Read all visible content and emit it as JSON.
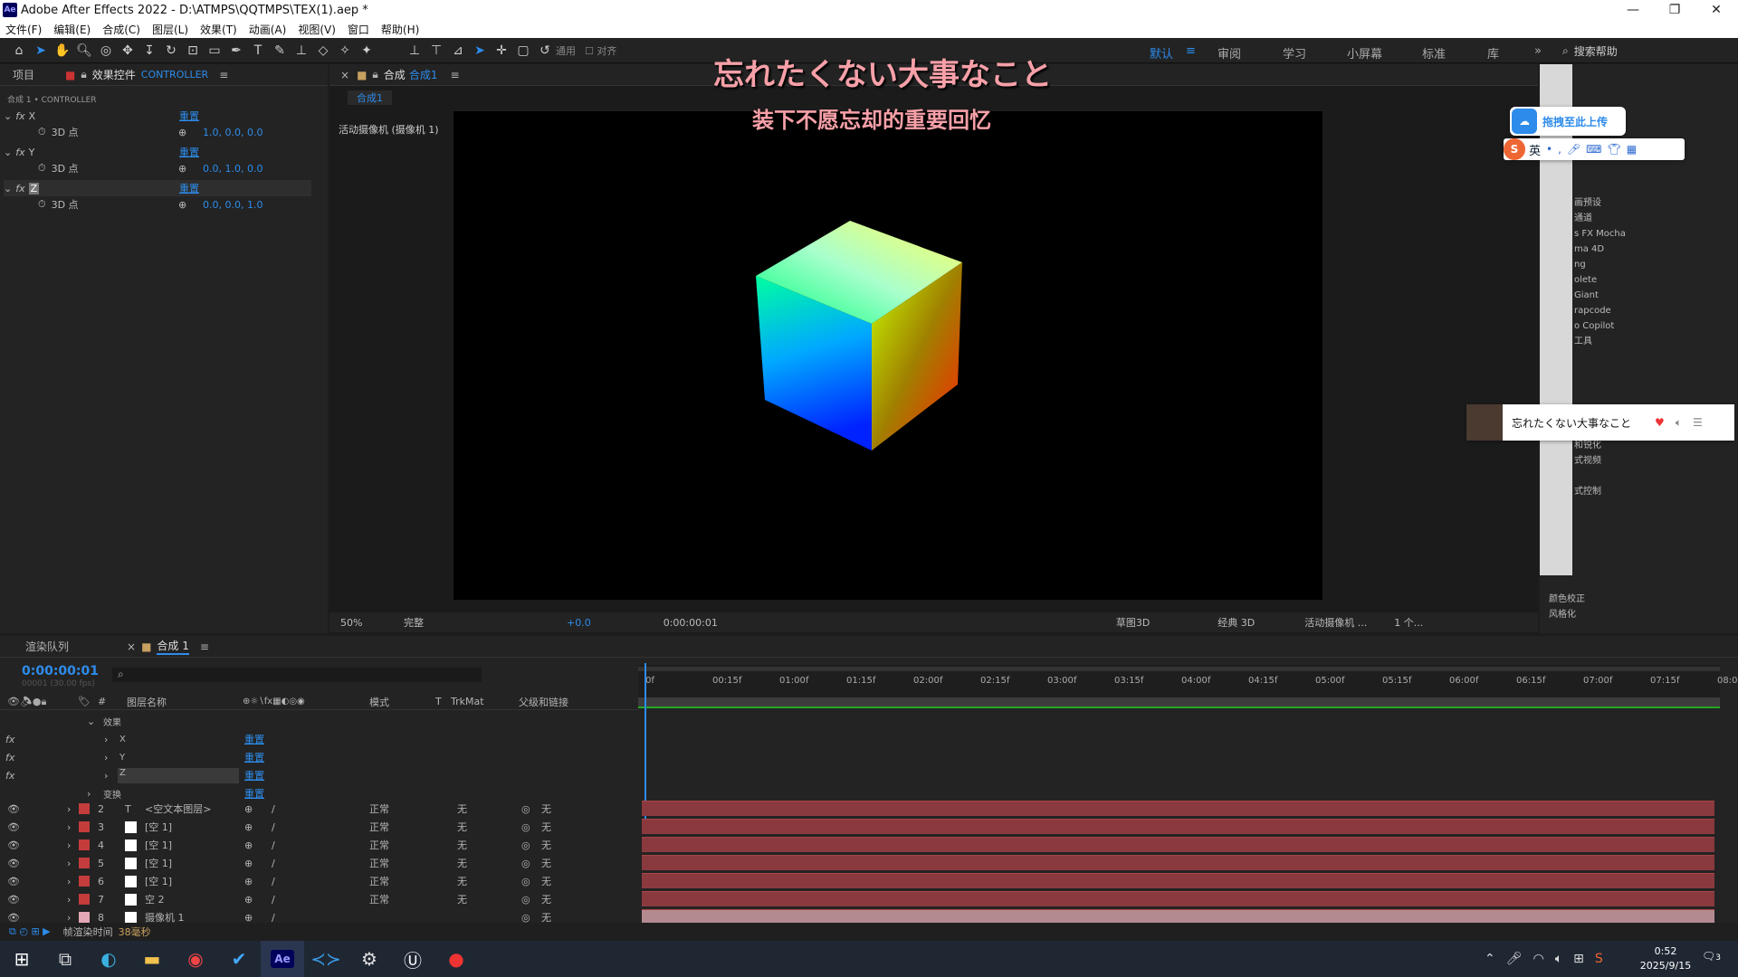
{
  "window": {
    "title": "Adobe After Effects 2022 - D:\\ATMPS\\QQTMPS\\TEX(1).aep *"
  },
  "menu": [
    "文件(F)",
    "编辑(E)",
    "合成(C)",
    "图层(L)",
    "效果(T)",
    "动画(A)",
    "视图(V)",
    "窗口",
    "帮助(H)"
  ],
  "toolbar": {
    "general": "通用",
    "align": "对齐"
  },
  "workspaces": [
    "默认",
    "审阅",
    "学习",
    "小屏幕",
    "标准",
    "库"
  ],
  "search_help": "搜索帮助",
  "overlay": {
    "jp": "忘れたくない大事なこと",
    "cn": "装下不愿忘却的重要回忆"
  },
  "effects_panel": {
    "tab_project": "项目",
    "tab_effects": "效果控件",
    "tab_target": "CONTROLLER",
    "breadcrumb": "合成 1 • CONTROLLER",
    "reset": "重置",
    "point_label": "3D 点",
    "effects": [
      {
        "name": "X",
        "value": "1.0, 0.0, 0.0"
      },
      {
        "name": "Y",
        "value": "0.0, 1.0, 0.0"
      },
      {
        "name": "Z",
        "value": "0.0, 0.0, 1.0"
      }
    ]
  },
  "comp_panel": {
    "tab": "合成",
    "comp_name": "合成1",
    "sub_tab": "合成1",
    "camera_label": "活动摄像机 (摄像机 1)",
    "zoom": "50%",
    "quality": "完整",
    "exposure": "+0.0",
    "timecode": "0:00:00:01",
    "draft3d": "草图3D",
    "renderer": "经典 3D",
    "camera": "活动摄像机 ...",
    "views": "1 个..."
  },
  "baidu_upload": "拖拽至此上传",
  "ime": {
    "lang": "英"
  },
  "music_popup": {
    "title": "忘れたくない大事なこと"
  },
  "right_panel_items": [
    "画预设",
    "通道",
    "s FX Mocha",
    "ma 4D",
    "ng",
    "olete",
    "Giant",
    "rapcode",
    "o Copilot",
    "工具",
    "和锐化",
    "式视频",
    "式控制",
    "颜色校正",
    "风格化"
  ],
  "timeline": {
    "tab_render": "渲染队列",
    "tab_comp": "合成 1",
    "timecode": "0:00:00:01",
    "fps": "00001 (30.00 fps)",
    "col_name": "图层名称",
    "col_mode": "模式",
    "col_t": "T",
    "col_trkmat": "TrkMat",
    "col_parent": "父级和链接",
    "effects_group": "效果",
    "sub_effects": [
      "X",
      "Y",
      "Z"
    ],
    "transform": "变换",
    "reset": "重置",
    "ticks": [
      "0f",
      "00:15f",
      "01:00f",
      "01:15f",
      "02:00f",
      "02:15f",
      "03:00f",
      "03:15f",
      "04:00f",
      "04:15f",
      "05:00f",
      "05:15f",
      "06:00f",
      "06:15f",
      "07:00f",
      "07:15f",
      "08:0"
    ],
    "layers": [
      {
        "num": "2",
        "icon": "T",
        "name": "<空文本图层>",
        "mode": "正常",
        "trk": "无",
        "parent": "无"
      },
      {
        "num": "3",
        "icon": "",
        "name": "[空 1]",
        "mode": "正常",
        "trk": "无",
        "parent": "无"
      },
      {
        "num": "4",
        "icon": "",
        "name": "[空 1]",
        "mode": "正常",
        "trk": "无",
        "parent": "无"
      },
      {
        "num": "5",
        "icon": "",
        "name": "[空 1]",
        "mode": "正常",
        "trk": "无",
        "parent": "无"
      },
      {
        "num": "6",
        "icon": "",
        "name": "[空 1]",
        "mode": "正常",
        "trk": "无",
        "parent": "无"
      },
      {
        "num": "7",
        "icon": "",
        "name": "空 2",
        "mode": "正常",
        "trk": "无",
        "parent": "无"
      },
      {
        "num": "8",
        "icon": "",
        "name": "摄像机 1",
        "mode": "",
        "trk": "",
        "parent": "无"
      }
    ],
    "render_time_label": "帧渲染时间",
    "render_time": "38毫秒"
  },
  "taskbar": {
    "time": "0:52",
    "date": "2025/9/15",
    "notif": "3"
  },
  "colors": {
    "accent": "#2d8ceb",
    "label_red": "#c43c3c",
    "bar": "#8a3a3f"
  }
}
